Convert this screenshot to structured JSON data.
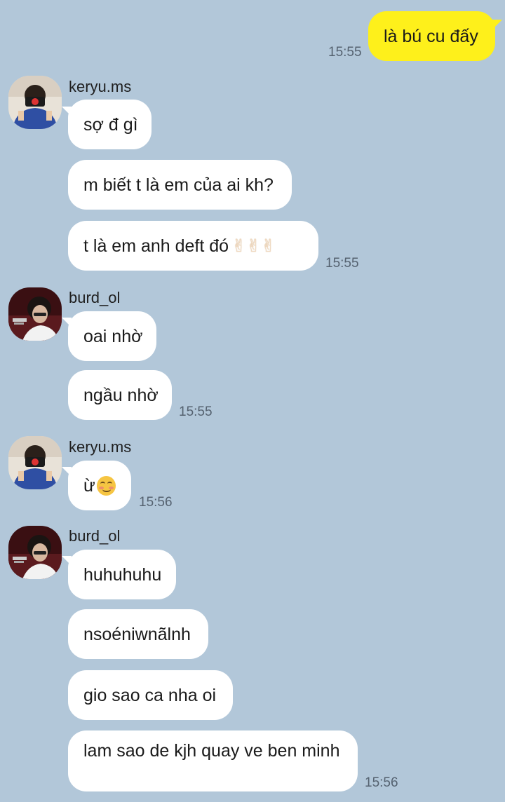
{
  "theme": {
    "background": "#b2c7d9",
    "my_bubble": "#fef01b",
    "their_bubble": "#ffffff",
    "time_color": "#556270"
  },
  "messages": {
    "m0": {
      "text": "là bú cu đấy",
      "time": "15:55"
    },
    "g1": {
      "sender": "keryu.ms",
      "b1": "sợ đ gì",
      "b2": "m biết t là em của ai kh?",
      "b3": "t là em anh deft đó",
      "b3_emoji": "✌✌✌",
      "time": "15:55"
    },
    "g2": {
      "sender": "burd_ol",
      "b1": "oai nhờ",
      "b2": "ngầu nhờ",
      "time": "15:55"
    },
    "g3": {
      "sender": "keryu.ms",
      "b1": "ừ",
      "time": "15:56"
    },
    "g4": {
      "sender": "burd_ol",
      "b1": "huhuhuhu",
      "b2": "nsoéniwnãlnh",
      "b3": "gio sao ca nha oi",
      "b4": "lam sao de kjh quay ve ben minh",
      "time": "15:56"
    }
  },
  "icons": {
    "avatar_keryu": "avatar-photo",
    "avatar_burd": "avatar-photo",
    "smile": "smiling-face-emoji",
    "victory": "victory-hand-emoji"
  }
}
